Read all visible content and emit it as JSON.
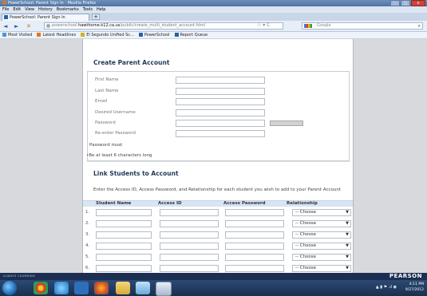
{
  "window": {
    "title": "PowerSchool: Parent Sign In - Mozilla Firefox",
    "controls": [
      "–",
      "□",
      "x"
    ]
  },
  "menu": [
    "File",
    "Edit",
    "View",
    "History",
    "Bookmarks",
    "Tools",
    "Help"
  ],
  "tab": {
    "label": "PowerSchool: Parent Sign In",
    "new_tab": "+"
  },
  "nav": {
    "back": "◄",
    "forward": "►",
    "home": "✕",
    "url_prefix": "powerschool.",
    "url_host": "hawthorne.k12.ca.us",
    "url_path": "/public/create_multi_student_account.html",
    "url_icons": "☆ ▾ C",
    "search_placeholder": "Google",
    "search_icon": "search-icon"
  },
  "bookmarks": [
    {
      "label": "Most Visited",
      "icon": "bookmark-icon",
      "color": "#5a8fd8"
    },
    {
      "label": "Latest Headlines",
      "icon": "rss-icon",
      "color": "#e8741b"
    },
    {
      "label": "El Segundo Unified Sc...",
      "icon": "school-icon",
      "color": "#d4b21c"
    },
    {
      "label": "PowerSchool",
      "icon": "powerschool-icon",
      "color": "#2a5fa8"
    },
    {
      "label": "Report Queue",
      "icon": "powerschool-icon",
      "color": "#2a5fa8"
    }
  ],
  "form": {
    "heading": "Create Parent Account",
    "fields": [
      {
        "label": "First Name"
      },
      {
        "label": "Last Name"
      },
      {
        "label": "Email"
      },
      {
        "label": "Desired Username"
      },
      {
        "label": "Password"
      },
      {
        "label": "Re-enter Password"
      }
    ],
    "password_note": "Password must",
    "password_rule": "•Be at least 6 characters long"
  },
  "link": {
    "heading": "Link Students to Account",
    "intro": "Enter the Access ID, Access Password, and Relationship for each student you wish to add to your Parent Account",
    "columns": [
      "Student Name",
      "Access ID",
      "Access Password",
      "Relationship"
    ],
    "rows": [
      {
        "num": "1.",
        "relationship": "-- Choose"
      },
      {
        "num": "2.",
        "relationship": "-- Choose"
      },
      {
        "num": "3.",
        "relationship": "-- Choose"
      },
      {
        "num": "4.",
        "relationship": "-- Choose"
      },
      {
        "num": "5.",
        "relationship": "-- Choose"
      },
      {
        "num": "6.",
        "relationship": "-- Choose"
      }
    ]
  },
  "branding": {
    "left": "ALWAYS LEARNING",
    "right": "PEARSON"
  },
  "taskbar": {
    "apps": [
      "start-orb",
      "chrome-icon",
      "ie-icon",
      "explorer-icon",
      "firefox-icon",
      "folder-icon",
      "media-icon",
      "paint-icon"
    ],
    "tray_icons": "▲ ▮ ⚑ .ıl ◉",
    "time": "4:11 PM",
    "date": "9/27/2012"
  },
  "colors": {
    "heading": "#233b5a",
    "table_header": "#d7e5f4",
    "brand_strip": "#1c2f52",
    "taskbar": "#2c4a74"
  }
}
